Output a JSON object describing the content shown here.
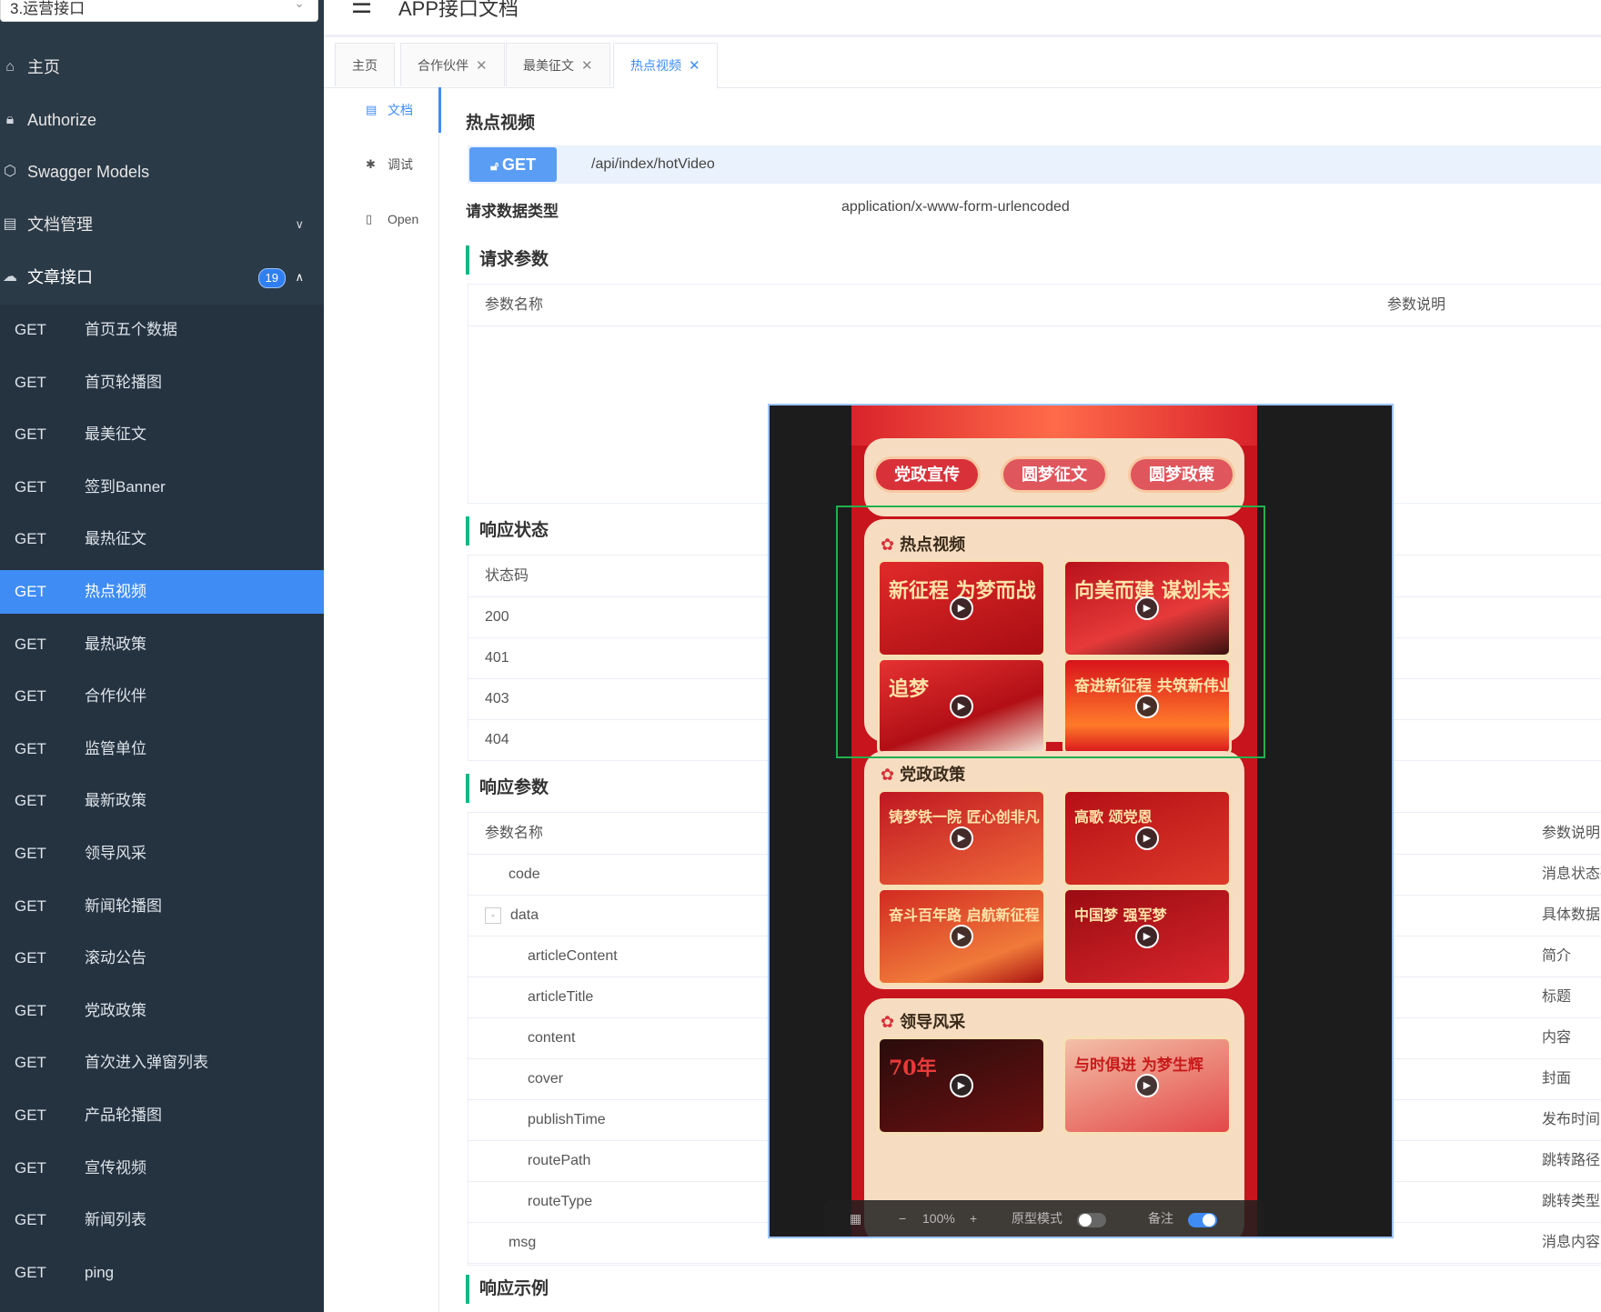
{
  "sidebar": {
    "group_select": "3.运营接口",
    "menu": [
      {
        "label": "主页",
        "icon": "home-icon"
      },
      {
        "label": "Authorize",
        "icon": "lock-icon"
      },
      {
        "label": "Swagger Models",
        "icon": "cube-icon"
      },
      {
        "label": "文档管理",
        "icon": "document-icon"
      },
      {
        "label": "文章接口",
        "icon": "cloud-icon",
        "badge": "19"
      }
    ],
    "apis": [
      {
        "method": "GET",
        "title": "首页五个数据"
      },
      {
        "method": "GET",
        "title": "首页轮播图"
      },
      {
        "method": "GET",
        "title": "最美征文"
      },
      {
        "method": "GET",
        "title": "签到Banner"
      },
      {
        "method": "GET",
        "title": "最热征文"
      },
      {
        "method": "GET",
        "title": "热点视频"
      },
      {
        "method": "GET",
        "title": "最热政策"
      },
      {
        "method": "GET",
        "title": "合作伙伴"
      },
      {
        "method": "GET",
        "title": "监管单位"
      },
      {
        "method": "GET",
        "title": "最新政策"
      },
      {
        "method": "GET",
        "title": "领导风采"
      },
      {
        "method": "GET",
        "title": "新闻轮播图"
      },
      {
        "method": "GET",
        "title": "滚动公告"
      },
      {
        "method": "GET",
        "title": "党政政策"
      },
      {
        "method": "GET",
        "title": "首次进入弹窗列表"
      },
      {
        "method": "GET",
        "title": "产品轮播图"
      },
      {
        "method": "GET",
        "title": "宣传视频"
      },
      {
        "method": "GET",
        "title": "新闻列表"
      },
      {
        "method": "GET",
        "title": "ping"
      }
    ],
    "active_api": "热点视频"
  },
  "header": {
    "title": "APP接口文档"
  },
  "tabs": [
    {
      "label": "主页",
      "closable": false
    },
    {
      "label": "合作伙伴",
      "closable": true
    },
    {
      "label": "最美征文",
      "closable": true
    },
    {
      "label": "热点视频",
      "closable": true,
      "active": true
    }
  ],
  "doc_tabs": [
    {
      "label": "文档",
      "active": true
    },
    {
      "label": "调试"
    },
    {
      "label": "Open"
    }
  ],
  "doc": {
    "title": "热点视频",
    "method": "GET",
    "path": "/api/index/hotVideo",
    "content_type_label": "请求数据类型",
    "content_type": "application/x-www-form-urlencoded",
    "request_params_title": "请求参数",
    "request_params_headers": [
      "参数名称",
      "参数说明"
    ],
    "response_status_title": "响应状态",
    "response_status_header": "状态码",
    "status_codes": [
      "200",
      "401",
      "403",
      "404"
    ],
    "response_params_title": "响应参数",
    "response_params_headers": [
      "参数名称",
      "参数说明"
    ],
    "response_params": [
      {
        "name": "code",
        "desc": "消息状态码",
        "level": 0
      },
      {
        "name": "data",
        "desc": "具体数据对",
        "level": 0,
        "expand": "-"
      },
      {
        "name": "articleContent",
        "desc": "简介",
        "level": 1
      },
      {
        "name": "articleTitle",
        "desc": "标题",
        "level": 1
      },
      {
        "name": "content",
        "desc": "内容",
        "level": 1
      },
      {
        "name": "cover",
        "desc": "封面",
        "level": 1
      },
      {
        "name": "publishTime",
        "desc": "发布时间",
        "level": 1
      },
      {
        "name": "routePath",
        "desc": "跳转路径",
        "level": 1
      },
      {
        "name": "routeType",
        "desc": "跳转类型（",
        "level": 1
      },
      {
        "name": "msg",
        "desc": "消息内容，",
        "level": 0
      }
    ],
    "response_example_title": "响应示例"
  },
  "preview": {
    "categories": [
      "党政宣传",
      "圆梦征文",
      "圆梦政策"
    ],
    "sections": [
      {
        "title": "热点视频",
        "thumbs": [
          "新征程 为梦而战",
          "向美而建 谋划未来",
          "追梦",
          "奋进新征程 共筑新伟业"
        ]
      },
      {
        "title": "党政政策",
        "thumbs": [
          "铸梦铁一院 匠心创非凡",
          "高歌 颂党恩",
          "奋斗百年路 启航新征程",
          "中国梦 强军梦"
        ]
      },
      {
        "title": "领导风采",
        "thumbs": [
          "70年",
          "与时俱进 为梦生辉"
        ]
      }
    ],
    "toolbar": {
      "zoom": "100%",
      "prototype_mode": "原型模式",
      "notes": "备注"
    }
  }
}
